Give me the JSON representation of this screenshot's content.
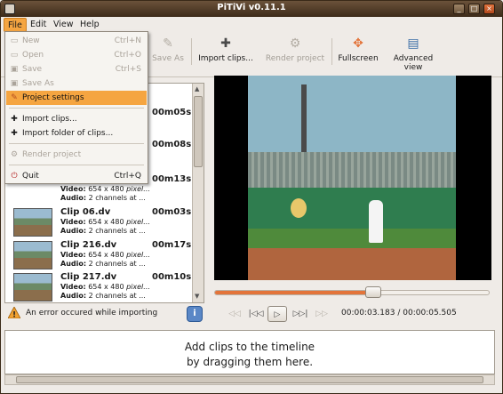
{
  "window": {
    "title": "PiTiVi v0.11.1",
    "controls": [
      "minimize",
      "maximize",
      "close"
    ]
  },
  "menubar": {
    "items": [
      {
        "label": "File",
        "active": true
      },
      {
        "label": "Edit",
        "active": false
      },
      {
        "label": "View",
        "active": false
      },
      {
        "label": "Help",
        "active": false
      }
    ]
  },
  "file_menu": {
    "items": [
      {
        "label": "New",
        "shortcut": "Ctrl+N",
        "enabled": false,
        "icon": "new-document-icon"
      },
      {
        "label": "Open",
        "shortcut": "Ctrl+O",
        "enabled": false,
        "icon": "open-folder-icon"
      },
      {
        "label": "Save",
        "shortcut": "Ctrl+S",
        "enabled": false,
        "icon": "save-icon"
      },
      {
        "label": "Save As",
        "shortcut": "",
        "enabled": false,
        "icon": "save-as-icon"
      },
      {
        "label": "Project settings",
        "shortcut": "",
        "enabled": true,
        "highlighted": true,
        "icon": "settings-icon"
      },
      {
        "label": "Import clips...",
        "shortcut": "",
        "enabled": true,
        "icon": "plus-icon"
      },
      {
        "label": "Import folder of clips...",
        "shortcut": "",
        "enabled": true,
        "icon": "plus-icon"
      },
      {
        "label": "Render project",
        "shortcut": "",
        "enabled": false,
        "icon": "render-icon"
      },
      {
        "label": "Quit",
        "shortcut": "Ctrl+Q",
        "enabled": true,
        "icon": "quit-icon"
      }
    ]
  },
  "toolbar": {
    "save_as_label": "Save As",
    "import_label": "Import clips...",
    "render_label": "Render project",
    "fullscreen_label": "Fullscreen",
    "advanced_label": "Advanced view"
  },
  "clips": [
    {
      "name": "",
      "duration": "00m05s",
      "video": "",
      "audio": ""
    },
    {
      "name": "",
      "duration": "00m08s",
      "video": "",
      "audio": ""
    },
    {
      "name": "",
      "duration": "00m13s",
      "video": "654 x 480",
      "video_tail": "pixel...",
      "audio": "2 channels at ..."
    },
    {
      "name": "Clip 06.dv",
      "duration": "00m03s",
      "video": "654 x 480",
      "video_tail": "pixel...",
      "audio": "2 channels at ..."
    },
    {
      "name": "Clip 216.dv",
      "duration": "00m17s",
      "video": "654 x 480",
      "video_tail": "pixel...",
      "audio": "2 channels at ..."
    },
    {
      "name": "Clip 217.dv",
      "duration": "00m10s",
      "video": "654 x 480",
      "video_tail": "pixel...",
      "audio": "2 channels at ..."
    }
  ],
  "clip_labels": {
    "video": "Video:",
    "audio": "Audio:"
  },
  "error": {
    "message": "An error occured while importing"
  },
  "player": {
    "position": "00:00:03.183",
    "separator": "/",
    "duration": "00:00:05.505",
    "progress": 0.578
  },
  "timeline": {
    "hint_line1": "Add clips to the timeline",
    "hint_line2": "by dragging them here."
  },
  "colors": {
    "accent": "#f5a541",
    "titlebar": "#3d2b1a",
    "seek_fill": "#e3743a"
  }
}
